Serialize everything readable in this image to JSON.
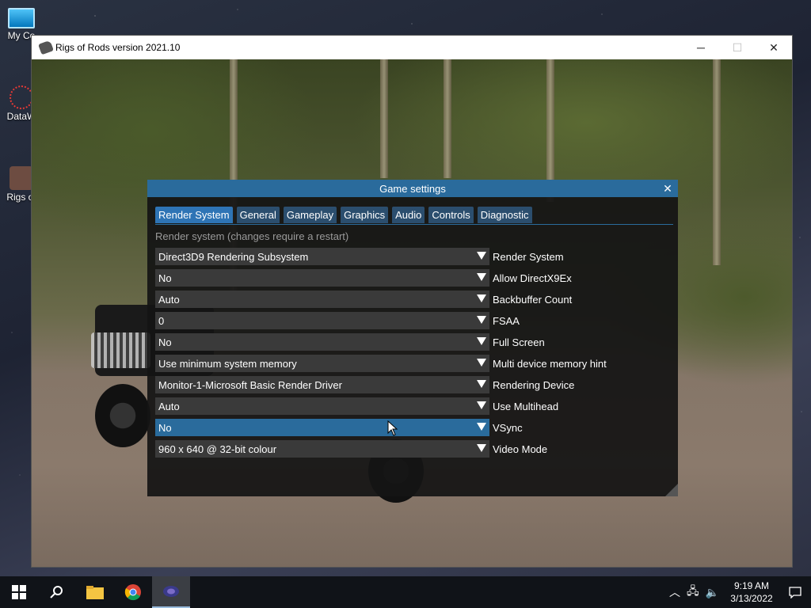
{
  "desktop": {
    "icons": [
      {
        "label": "My Co"
      },
      {
        "label": "DataW"
      },
      {
        "label": "Rigs of"
      }
    ]
  },
  "window": {
    "title": "Rigs of Rods version 2021.10",
    "minimize_symbol": "─",
    "maximize_symbol": "☐",
    "close_symbol": "✕"
  },
  "dialog": {
    "title": "Game settings",
    "close_symbol": "✕",
    "tabs": [
      {
        "label": "Render System",
        "active": true
      },
      {
        "label": "General"
      },
      {
        "label": "Gameplay"
      },
      {
        "label": "Graphics"
      },
      {
        "label": "Audio"
      },
      {
        "label": "Controls"
      },
      {
        "label": "Diagnostic"
      }
    ],
    "section_label": "Render system (changes require a restart)",
    "rows": [
      {
        "value": "Direct3D9 Rendering Subsystem",
        "label": "Render System"
      },
      {
        "value": "No",
        "label": "Allow DirectX9Ex"
      },
      {
        "value": "Auto",
        "label": "Backbuffer Count"
      },
      {
        "value": "0",
        "label": "FSAA"
      },
      {
        "value": "No",
        "label": "Full Screen"
      },
      {
        "value": "Use minimum system memory",
        "label": "Multi device memory hint"
      },
      {
        "value": "Monitor-1-Microsoft Basic Render Driver",
        "label": "Rendering Device"
      },
      {
        "value": "Auto",
        "label": "Use Multihead"
      },
      {
        "value": "No",
        "label": "VSync",
        "highlighted": true
      },
      {
        "value": "960 x 640 @ 32-bit colour",
        "label": "Video Mode"
      }
    ]
  },
  "taskbar": {
    "start_icon": "windows-start-icon",
    "search_icon": "search-icon",
    "apps": [
      "file-explorer-icon",
      "chrome-icon",
      "rigs-of-rods-icon"
    ],
    "clock": {
      "time": "9:19 AM",
      "date": "3/13/2022"
    }
  },
  "colors": {
    "accent": "#2a6b9c",
    "tab_active": "#2e74b5",
    "combo_bg": "#3a3a3a"
  }
}
